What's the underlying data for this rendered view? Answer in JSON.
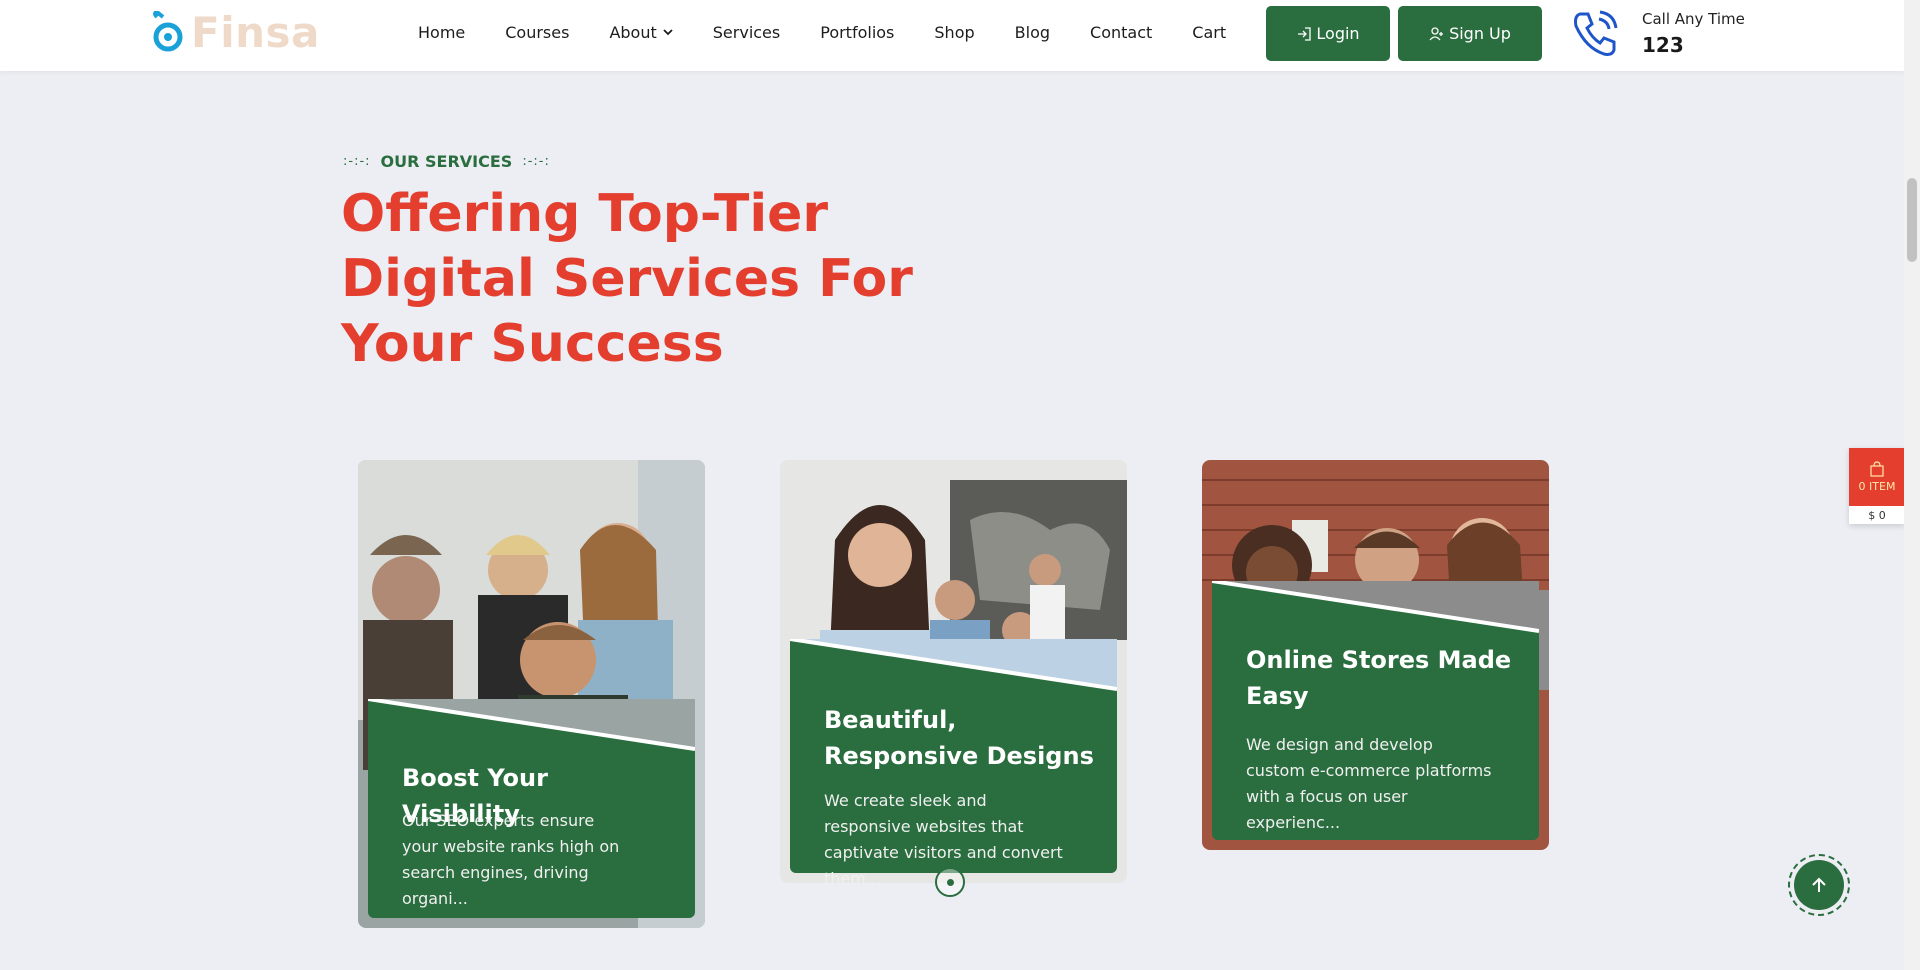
{
  "brand": {
    "name": "Finsa"
  },
  "nav": {
    "items": [
      {
        "label": "Home"
      },
      {
        "label": "Courses"
      },
      {
        "label": "About",
        "has_dropdown": true
      },
      {
        "label": "Services"
      },
      {
        "label": "Portfolios"
      },
      {
        "label": "Shop"
      },
      {
        "label": "Blog"
      },
      {
        "label": "Contact"
      },
      {
        "label": "Cart"
      }
    ],
    "login_label": "Login",
    "signup_label": "Sign Up"
  },
  "contact": {
    "call_label": "Call Any Time",
    "phone": "123"
  },
  "section": {
    "eyebrow": "OUR SERVICES",
    "eyebrow_dots": ":-:-:",
    "headline_lines": [
      "Offering Top-Tier",
      "Digital Services For",
      "Your Success"
    ]
  },
  "cards": [
    {
      "title": "Boost Your Visibility",
      "text": "Our SEO experts ensure your website ranks high on search engines, driving organi..."
    },
    {
      "title": "Beautiful, Responsive Designs",
      "text": "We create sleek and responsive websites that captivate visitors and convert them..."
    },
    {
      "title": "Online Stores Made Easy",
      "text": "We design and develop custom e-commerce platforms with a focus on user experienc..."
    }
  ],
  "cart_widget": {
    "items_label": "0 ITEM",
    "total": "$ 0"
  },
  "colors": {
    "primary_green": "#2a6d3f",
    "accent_red": "#e43e2f",
    "background": "#edeef3"
  }
}
